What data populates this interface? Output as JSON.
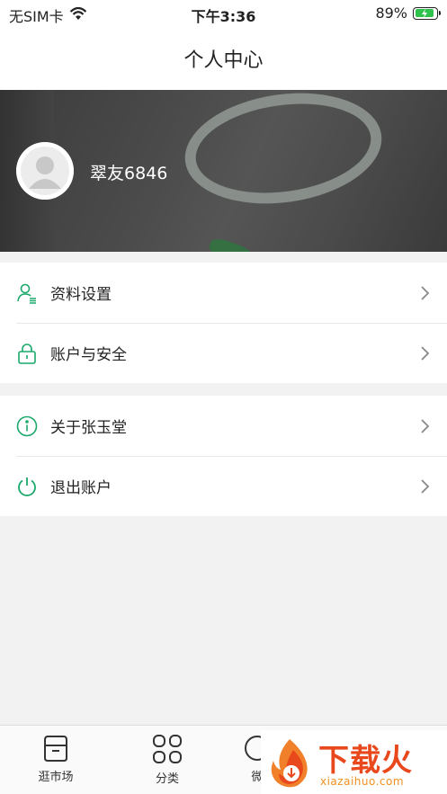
{
  "status_bar": {
    "carrier": "无SIM卡",
    "time": "下午3:36",
    "battery": "89%",
    "battery_level": 0.89
  },
  "nav": {
    "title": "个人中心"
  },
  "profile": {
    "username": "翠友6846"
  },
  "menu_groups": [
    [
      {
        "label": "资料设置",
        "icon": "profile-settings-icon"
      },
      {
        "label": "账户与安全",
        "icon": "lock-icon"
      }
    ],
    [
      {
        "label": "关于张玉堂",
        "icon": "info-icon"
      },
      {
        "label": "退出账户",
        "icon": "power-icon"
      }
    ]
  ],
  "tabbar": {
    "items": [
      {
        "label": "逛市场",
        "icon": "market-icon"
      },
      {
        "label": "分类",
        "icon": "category-grid-icon"
      },
      {
        "label": "微",
        "icon": "wechat-icon"
      }
    ]
  },
  "watermark": {
    "title": "下载火",
    "url": "xiazaihuo.com"
  },
  "colors": {
    "accent": "#1aa86b",
    "watermark": "#e8481c"
  }
}
